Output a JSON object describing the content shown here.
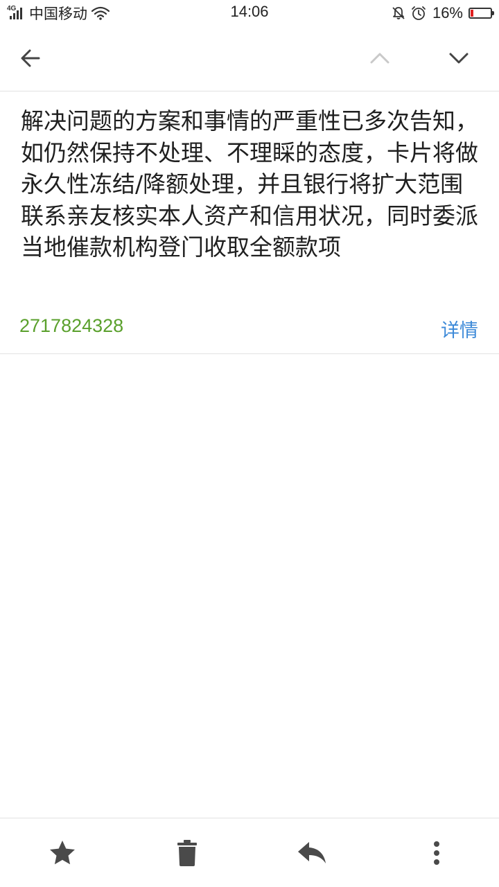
{
  "status_bar": {
    "network": "4G",
    "carrier": "中国移动",
    "time": "14:06",
    "battery_percent_text": "16%",
    "battery_level": 0.16,
    "icons": [
      "signal-icon",
      "wifi-icon",
      "mute-icon",
      "alarm-icon",
      "battery-icon"
    ]
  },
  "nav": {
    "icons": [
      "back-arrow-icon",
      "chevron-up-icon",
      "chevron-down-icon"
    ]
  },
  "message": {
    "body": "解决问题的方案和事情的严重性已多次告知，如仍然保持不处理、不理睬的态度，卡片将做永久性冻结/降额处理，并且银行将扩大范围联系亲友核实本人资产和信用状况，同时委派当地催款机构登门收取全额款项",
    "sender": "2717824328",
    "details_label": "详情"
  },
  "toolbar": {
    "icons": [
      "star-icon",
      "trash-icon",
      "reply-icon",
      "more-vertical-icon"
    ]
  },
  "colors": {
    "sender": "#5aa02c",
    "link": "#3d8ad8",
    "battery_low": "#e02020",
    "divider": "#e2e2e2"
  }
}
